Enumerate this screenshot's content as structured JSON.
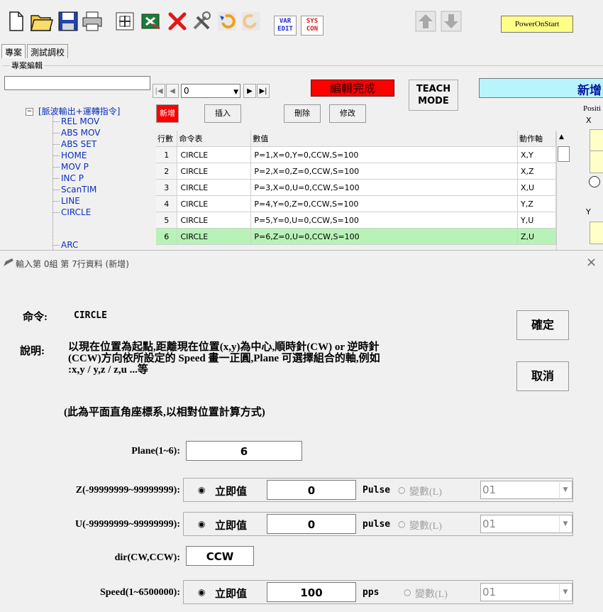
{
  "toolbar": {
    "icons": [
      "new-file-icon",
      "open-folder-icon",
      "save-icon",
      "print-icon",
      "add-icon",
      "excel-export-icon",
      "delete-icon",
      "tools-icon",
      "undo-icon",
      "redo-icon"
    ],
    "var_edit": [
      "VAR",
      "EDIT"
    ],
    "sys_con": [
      "SYS",
      "CON"
    ],
    "poweron_label": "PowerOnStart"
  },
  "tabs": [
    "專案",
    "測試調校"
  ],
  "group_label": "專案編輯",
  "navigator": {
    "index_value": "0"
  },
  "edit_done_label": "編輯完成",
  "teach_mode": [
    "TEACH",
    "MODE"
  ],
  "new_label": "新增",
  "right_panel": {
    "position_label": "Positi",
    "x_label": "X",
    "y_label": "Y"
  },
  "tree": {
    "root": "[脈波輸出+運轉指令]",
    "expander": "−",
    "items": [
      "REL MOV",
      "ABS MOV",
      "ABS SET",
      "HOME",
      "MOV P",
      "INC P",
      "ScanTIM",
      "LINE",
      "CIRCLE",
      "ARC"
    ]
  },
  "actions": {
    "add": "新增",
    "insert": "插入",
    "delete": "刪除",
    "modify": "修改"
  },
  "table": {
    "headers": [
      "行數",
      "命令表",
      "數值",
      "動作軸"
    ],
    "rows": [
      {
        "n": "1",
        "cmd": "CIRCLE",
        "val": "P=1,X=0,Y=0,CCW,S=100",
        "axis": "X,Y"
      },
      {
        "n": "2",
        "cmd": "CIRCLE",
        "val": "P=2,X=0,Z=0,CCW,S=100",
        "axis": "X,Z"
      },
      {
        "n": "3",
        "cmd": "CIRCLE",
        "val": "P=3,X=0,U=0,CCW,S=100",
        "axis": "X,U"
      },
      {
        "n": "4",
        "cmd": "CIRCLE",
        "val": "P=4,Y=0,Z=0,CCW,S=100",
        "axis": "Y,Z"
      },
      {
        "n": "5",
        "cmd": "CIRCLE",
        "val": "P=5,Y=0,U=0,CCW,S=100",
        "axis": "Y,U"
      },
      {
        "n": "6",
        "cmd": "CIRCLE",
        "val": "P=6,Z=0,U=0,CCW,S=100",
        "axis": "Z,U",
        "selected": true
      }
    ]
  },
  "dialog": {
    "title": "輸入第 0組 第 7行資料 (新增)",
    "close": "×",
    "command_label": "命令:",
    "command_value": "CIRCLE",
    "desc_label": "說明:",
    "desc_line1": "以現在位置為起點,距離現在位置(x,y)為中心,順時針(CW) or 逆時針",
    "desc_line2": "(CCW)方向依所設定的 Speed 畫一正圓,Plane 可選擇組合的軸,例如",
    "desc_line3": ":x,y / y,z / z,u ...等",
    "note": "(此為平面直角座標系,以相對位置計算方式)",
    "ok": "確定",
    "cancel": "取消",
    "plane_label": "Plane(1~6):",
    "plane_value": "6",
    "z_label": "Z(-99999999~99999999):",
    "z_value": "0",
    "z_unit": "Pulse",
    "u_label": "U(-99999999~99999999):",
    "u_value": "0",
    "u_unit": "pulse",
    "dir_label": "dir(CW,CCW):",
    "dir_value": "CCW",
    "speed_label": "Speed(1~6500000):",
    "speed_value": "100",
    "speed_unit": "pps",
    "immediate_label": "立即值",
    "variable_label": "變數(L)",
    "variable_value": "01"
  }
}
